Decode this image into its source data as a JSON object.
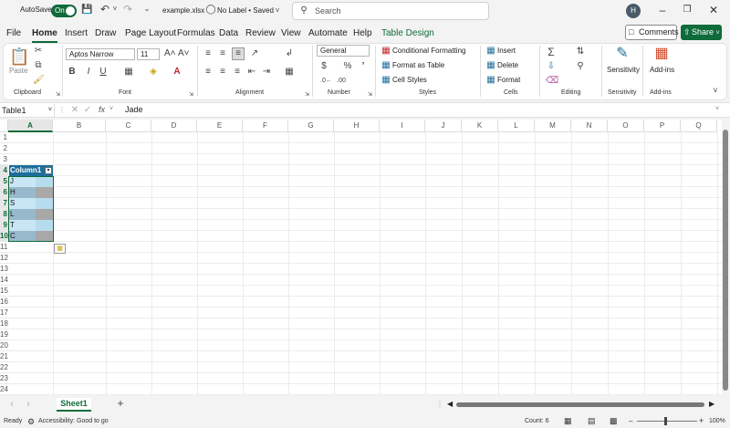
{
  "titlebar": {
    "autosave_label": "AutoSave",
    "autosave_state": "On",
    "filename": "example.xlsx",
    "label_status": "No Label • Saved",
    "save_chevron": "⌄",
    "search_placeholder": "Search",
    "user_initial": "H",
    "win_min": "–",
    "win_max": "❐",
    "win_close": "✕"
  },
  "tabs": [
    "File",
    "Home",
    "Insert",
    "Draw",
    "Page Layout",
    "Formulas",
    "Data",
    "Review",
    "View",
    "Automate",
    "Help",
    "Table Design"
  ],
  "active_tab": "Home",
  "buttons": {
    "comments": "Comments",
    "share": "Share"
  },
  "ribbon": {
    "clipboard": {
      "paste": "Paste",
      "group": "Clipboard"
    },
    "font": {
      "name": "Aptos Narrow",
      "size": "11",
      "bold": "B",
      "italic": "I",
      "underline": "U",
      "grow": "A˄",
      "shrink": "A˅",
      "group": "Font"
    },
    "alignment": {
      "group": "Alignment"
    },
    "number": {
      "format": "General",
      "currency": "$",
      "percent": "%",
      "comma": "’",
      "group": "Number"
    },
    "styles": {
      "conditional": "Conditional Formatting",
      "format_table": "Format as Table",
      "cell_styles": "Cell Styles",
      "group": "Styles"
    },
    "cells": {
      "insert": "Insert",
      "delete": "Delete",
      "format": "Format",
      "group": "Cells"
    },
    "editing": {
      "group": "Editing",
      "sum": "Σ"
    },
    "sensitivity": {
      "label": "Sensitivity",
      "group": "Sensitivity"
    },
    "addins": {
      "label": "Add-ins",
      "group": "Add-ins"
    }
  },
  "formula_bar": {
    "name_box": "Table1",
    "fx": "fx",
    "value": "Jade"
  },
  "columns": [
    "A",
    "B",
    "C",
    "D",
    "E",
    "F",
    "G",
    "H",
    "I",
    "J",
    "K",
    "L",
    "M",
    "N",
    "O",
    "P",
    "Q"
  ],
  "rows": [
    "1",
    "2",
    "3",
    "4",
    "5",
    "6",
    "7",
    "8",
    "9",
    "10",
    "11",
    "12",
    "13",
    "14",
    "15",
    "16",
    "17",
    "18",
    "19",
    "20",
    "21",
    "22",
    "23",
    "24"
  ],
  "table": {
    "header": "Column1",
    "cells": [
      "J",
      "H",
      "S",
      "L",
      "T",
      "C"
    ]
  },
  "colors": {
    "accent": "#0f6b3a",
    "table_header": "#1e6e9a",
    "band_light": "#c9e6f5",
    "band_dark": "#98b9cc"
  },
  "sheets": {
    "active": "Sheet1",
    "add": "+"
  },
  "status": {
    "ready": "Ready",
    "accessibility": "Accessibility: Good to go",
    "count": "Count: 6",
    "zoom": "100%"
  }
}
